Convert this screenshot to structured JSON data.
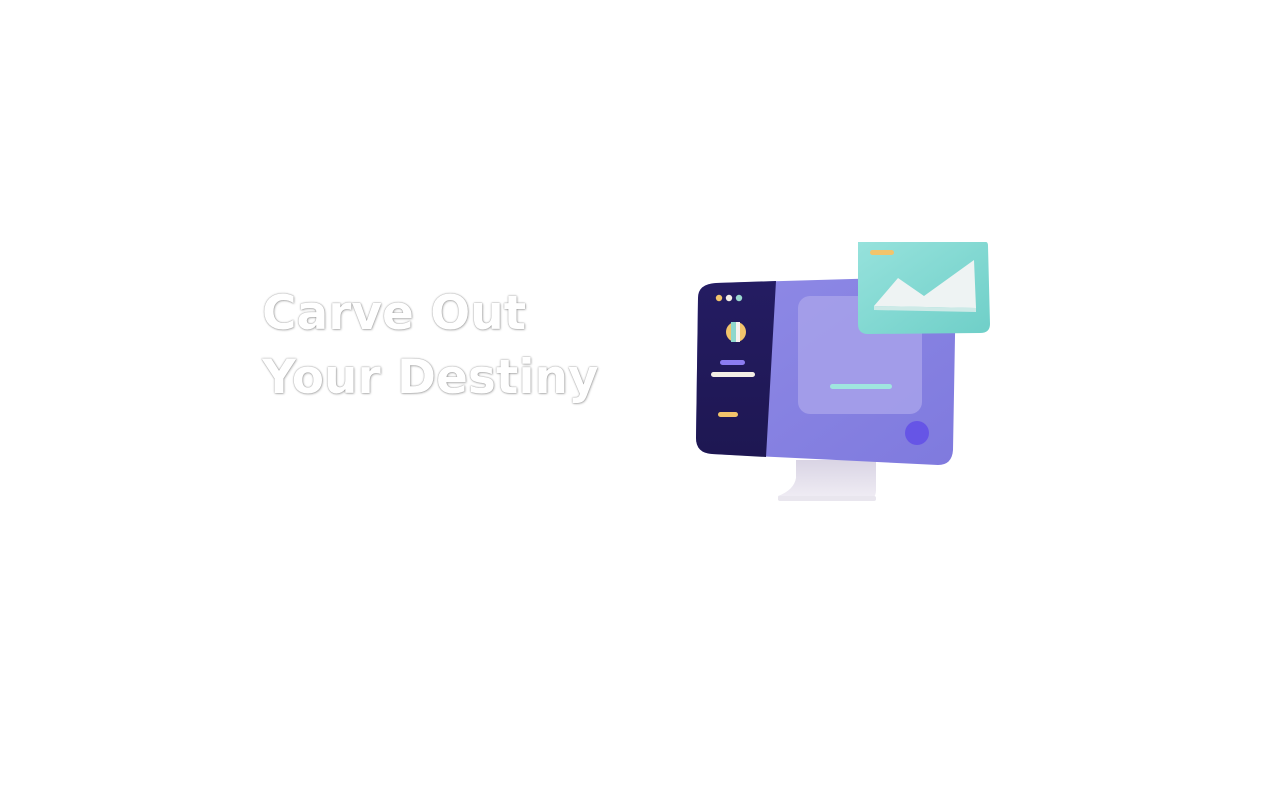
{
  "hero": {
    "headline_line1": "Carve Out",
    "headline_line2": "Your Destiny"
  },
  "illustration": {
    "icon": "computer-monitor-with-image-card",
    "colors": {
      "sidebar": "#221a5c",
      "screen": "#8a86e3",
      "panel": "#a39dea",
      "card": "#86dcd6",
      "accent_dot": "#6655e6",
      "stand": "#e6e3ea",
      "bar_teal": "#9fe6df",
      "bar_yellow": "#f2c46b",
      "bar_purple": "#8b7cf0"
    }
  }
}
